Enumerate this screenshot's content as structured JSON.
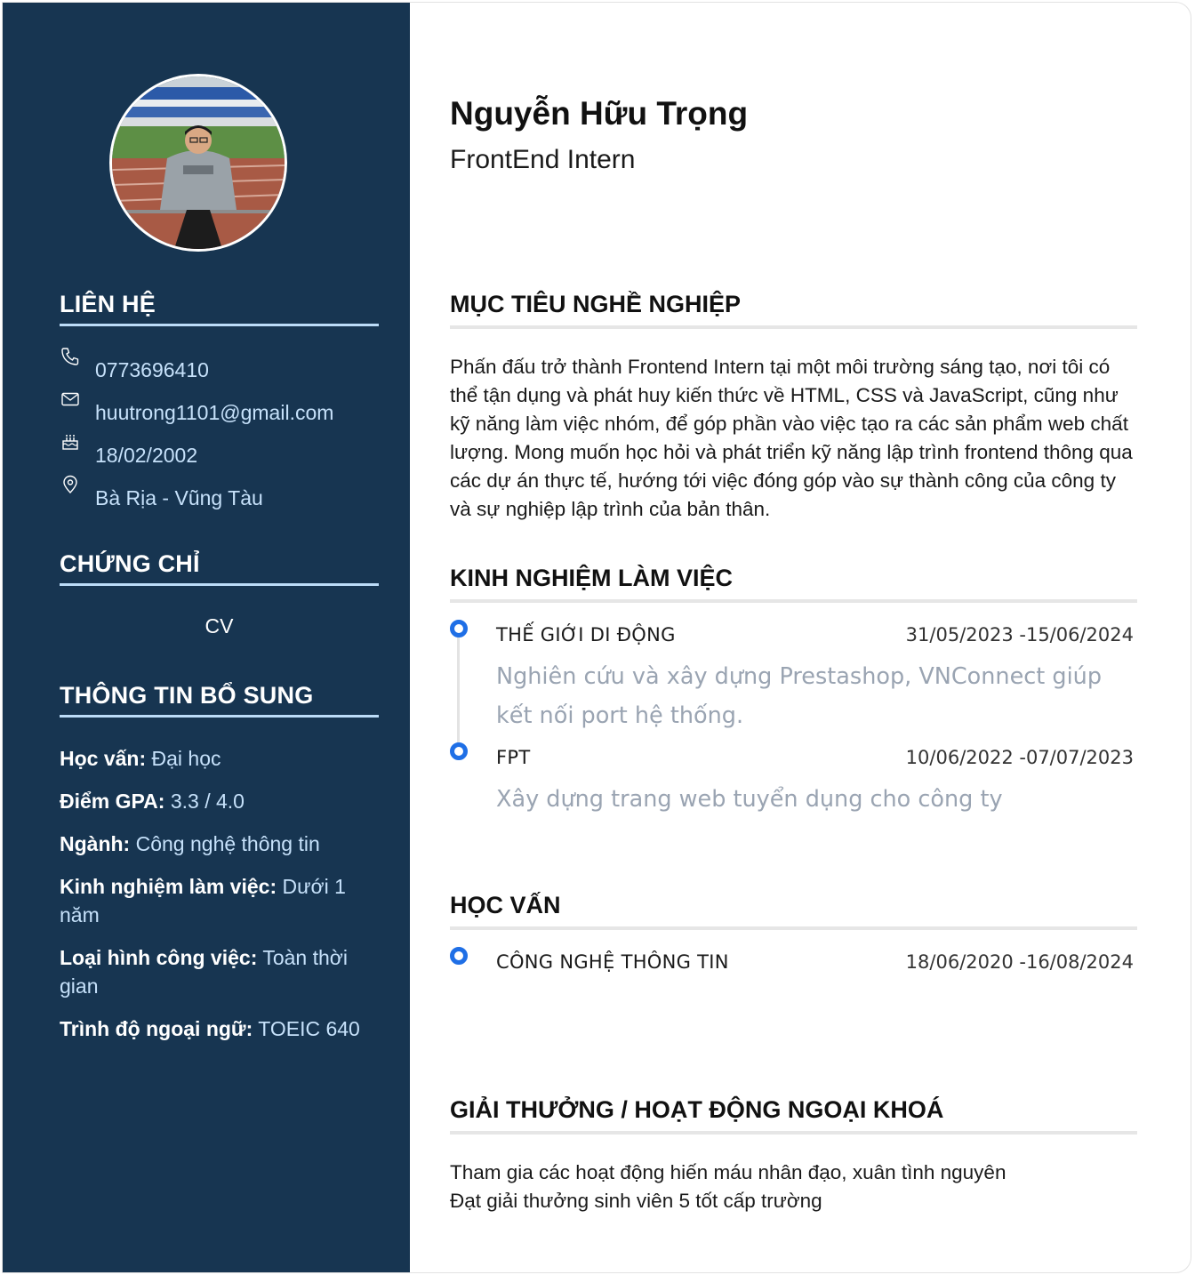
{
  "profile": {
    "name": "Nguyễn Hữu Trọng",
    "role": "FrontEnd Intern"
  },
  "sidebar": {
    "contact": {
      "heading": "LIÊN HỆ",
      "items": [
        {
          "icon": "phone-icon",
          "value": "0773696410"
        },
        {
          "icon": "mail-icon",
          "value": "huutrong1101@gmail.com"
        },
        {
          "icon": "cake-icon",
          "value": "18/02/2002"
        },
        {
          "icon": "location-icon",
          "value": "Bà Rịa - Vũng Tàu"
        }
      ]
    },
    "certificates": {
      "heading": "CHỨNG CHỈ",
      "items": [
        "CV"
      ]
    },
    "additional": {
      "heading": "THÔNG TIN BỔ SUNG",
      "items": [
        {
          "label": "Học vấn:",
          "value": "Đại học"
        },
        {
          "label": "Điểm GPA:",
          "value": "3.3 / 4.0"
        },
        {
          "label": "Ngành:",
          "value": "Công nghệ thông tin"
        },
        {
          "label": "Kinh nghiệm làm việc:",
          "value": "Dưới 1 năm"
        },
        {
          "label": "Loại hình công việc:",
          "value": "Toàn thời gian"
        },
        {
          "label": "Trình độ ngoại ngữ:",
          "value": "TOEIC 640"
        }
      ]
    }
  },
  "main": {
    "objective": {
      "heading": "MỤC TIÊU NGHỀ NGHIỆP",
      "text": "Phấn đấu trở thành Frontend Intern tại một môi trường sáng tạo, nơi tôi có thể tận dụng và phát huy kiến thức về HTML, CSS và JavaScript, cũng như kỹ năng làm việc nhóm, để góp phần vào việc tạo ra các sản phẩm web chất lượng. Mong muốn học hỏi và phát triển kỹ năng lập trình frontend thông qua các dự án thực tế, hướng tới việc đóng góp vào sự thành công của công ty và sự nghiệp lập trình của bản thân."
    },
    "experience": {
      "heading": "KINH NGHIỆM LÀM VIỆC",
      "items": [
        {
          "company": "THẾ GIỚI DI ĐỘNG",
          "date": "31/05/2023 -15/06/2024",
          "description": "Nghiên cứu và xây dựng Prestashop, VNConnect giúp kết nối port hệ thống."
        },
        {
          "company": "FPT",
          "date": "10/06/2022 -07/07/2023",
          "description": "Xây dựng trang web tuyển dụng cho công ty"
        }
      ]
    },
    "education": {
      "heading": "HỌC VẤN",
      "items": [
        {
          "major": "CÔNG NGHỆ THÔNG TIN",
          "date": "18/06/2020 -16/08/2024"
        }
      ]
    },
    "awards": {
      "heading": "GIẢI THƯỞNG / HOẠT ĐỘNG NGOẠI KHOÁ",
      "lines": [
        "Tham gia các hoạt động hiến máu nhân đạo, xuân tình nguyên",
        "Đạt giải thưởng sinh viên 5 tốt cấp trường"
      ]
    }
  },
  "colors": {
    "sidebar_bg": "#173551",
    "sidebar_accent": "#bcdcf8",
    "sidebar_value": "#c6e1fa",
    "timeline_dot": "#1f6fe6",
    "description_text": "#9aa4b2"
  }
}
